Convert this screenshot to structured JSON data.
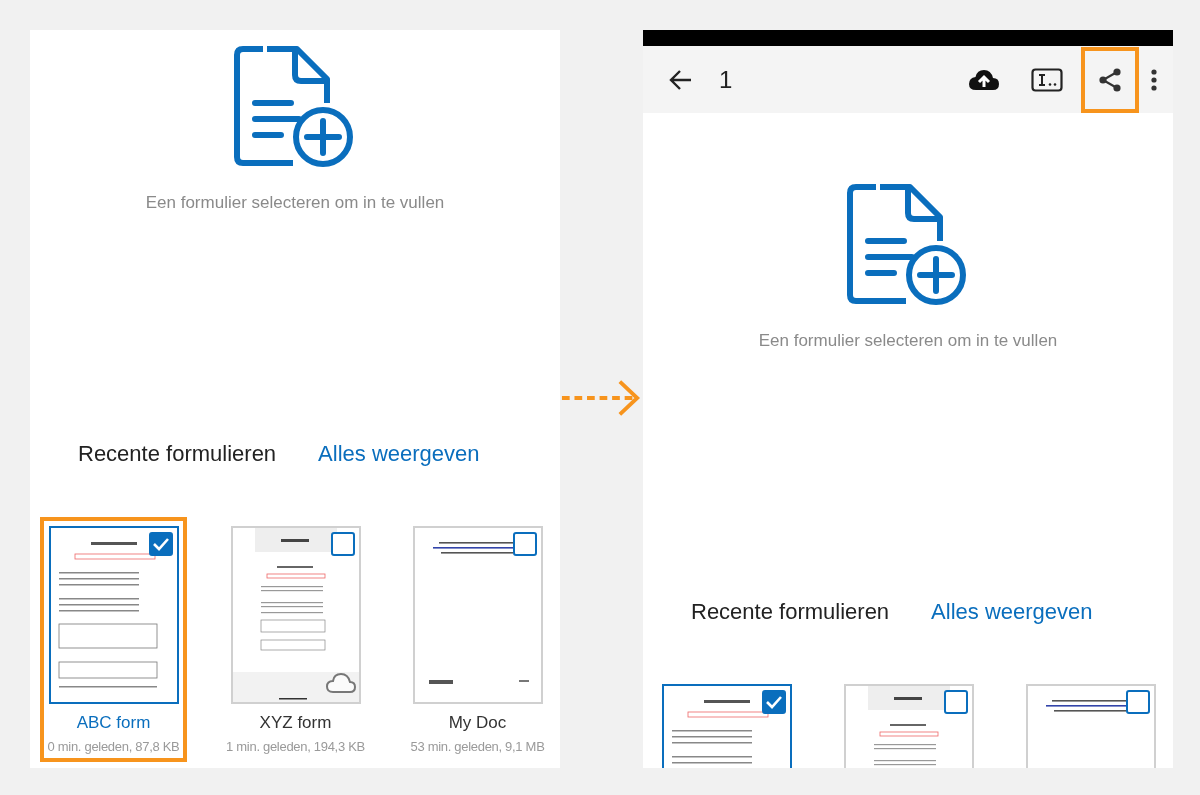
{
  "panels": [
    {
      "kind": "plain",
      "prompt": "Een formulier selecteren om in te vullen",
      "recent_title": "Recente formulieren",
      "show_all": "Alles weergeven",
      "cards": [
        {
          "kind": "form",
          "title": "ABC form",
          "meta": "0 min. geleden, 87,8 KB",
          "selected": true,
          "highlighted": true
        },
        {
          "kind": "app-form",
          "title": "XYZ form",
          "meta": "1 min. geleden, 194,3 KB",
          "selected": false,
          "highlighted": false,
          "cloud": true
        },
        {
          "kind": "letter",
          "title": "My Doc",
          "meta": "53 min. geleden, 9,1 MB",
          "selected": false,
          "highlighted": false
        }
      ]
    },
    {
      "kind": "app",
      "toolbar": {
        "page": "1",
        "actions": [
          {
            "kind": "upload",
            "highlighted": false
          },
          {
            "kind": "text-field",
            "highlighted": false
          },
          {
            "kind": "share",
            "highlighted": true
          },
          {
            "kind": "more",
            "highlighted": false
          }
        ]
      },
      "prompt": "Een formulier selecteren om in te vullen",
      "recent_title": "Recente formulieren",
      "show_all": "Alles weergeven",
      "cards": [
        {
          "kind": "form",
          "selected": true,
          "highlighted": false
        },
        {
          "kind": "app-form",
          "selected": false,
          "highlighted": false
        },
        {
          "kind": "letter",
          "selected": false,
          "highlighted": false
        }
      ]
    }
  ]
}
